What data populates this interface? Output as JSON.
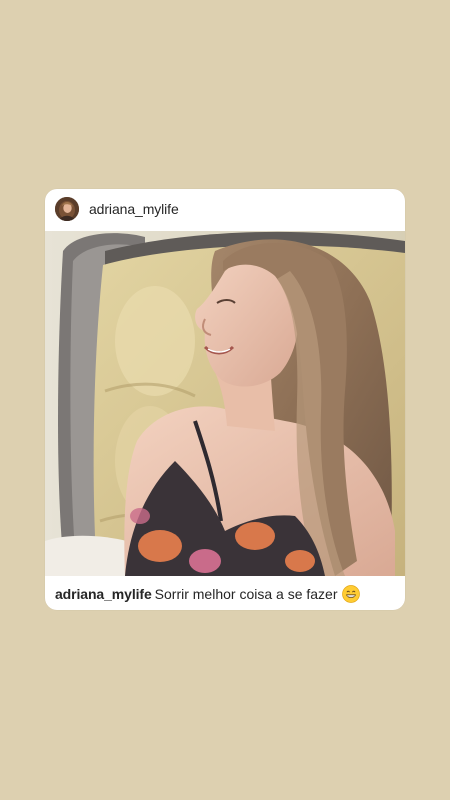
{
  "app": {
    "background_color": "#ddd0b0"
  },
  "post": {
    "header": {
      "username": "adriana_mylife",
      "avatar_icon": "profile-avatar"
    },
    "image": {
      "description_icon": "post-photo"
    },
    "caption": {
      "username": "adriana_mylife",
      "text": "Sorrir melhor coisa a se fazer",
      "emoji_icon": "grinning-face-icon"
    }
  }
}
